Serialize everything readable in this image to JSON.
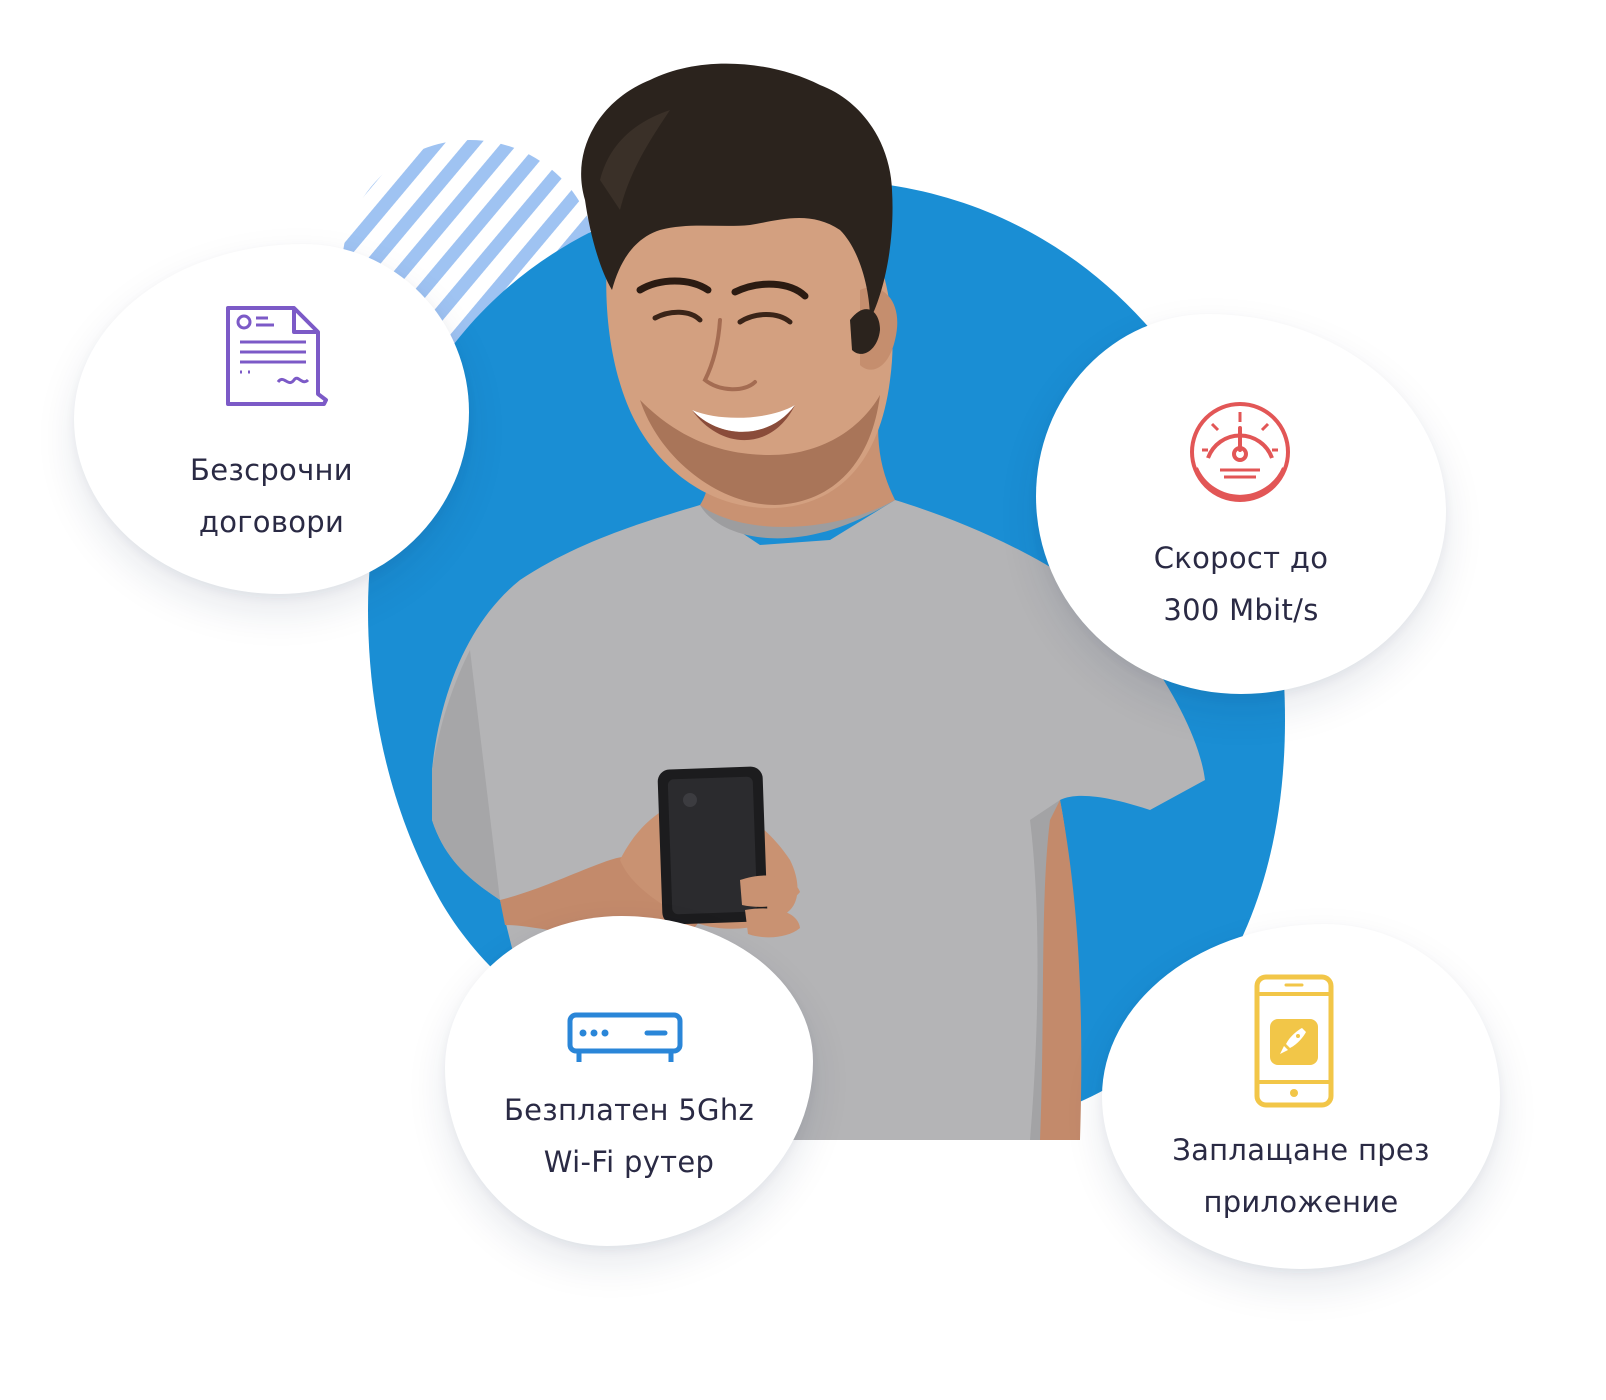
{
  "features": [
    {
      "icon": "contract-document-icon",
      "label_line1": "Безсрочни",
      "label_line2": "договори",
      "icon_color": "#7c5ac7"
    },
    {
      "icon": "speedometer-icon",
      "label_line1": "Скорост до",
      "label_line2": "300 Mbit/s",
      "icon_color": "#e25656"
    },
    {
      "icon": "router-icon",
      "label_line1": "Безплатен 5Ghz",
      "label_line2": "Wi-Fi рутер",
      "icon_color": "#2a86d8"
    },
    {
      "icon": "smartphone-app-icon",
      "label_line1": "Заплащане през",
      "label_line2": "приложение",
      "icon_color": "#f2c648"
    }
  ],
  "colors": {
    "blue_circle": "#1a8ed4",
    "stripes": "#9fc3f2",
    "label_text": "#2a2a44"
  },
  "hero_image": "smiling-man-with-phone"
}
